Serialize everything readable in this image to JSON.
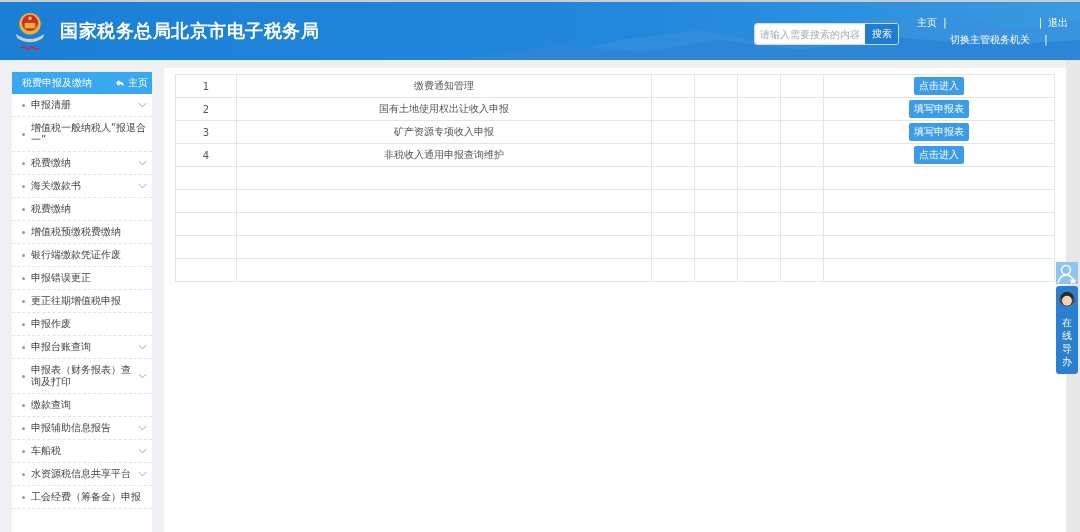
{
  "header": {
    "title": "国家税务总局北京市电子税务局",
    "search": {
      "placeholder": "请输入需要搜索的内容",
      "button": "搜索"
    },
    "links": [
      {
        "kind": "link",
        "label": "主页"
      },
      {
        "kind": "separator",
        "label": "|"
      },
      {
        "kind": "gap"
      },
      {
        "kind": "separator",
        "label": "|"
      },
      {
        "kind": "link",
        "label": "退出"
      }
    ],
    "switch_link": "切换主管税务机关",
    "switch_separator": "|"
  },
  "sidebar": {
    "title": "税费申报及缴纳",
    "home_link": "主页",
    "items": [
      {
        "label": "申报清册",
        "expandable": true
      },
      {
        "label": "增值税一般纳税人“报退合一”",
        "expandable": false
      },
      {
        "label": "税费缴纳",
        "expandable": true
      },
      {
        "label": "海关缴款书",
        "expandable": true
      },
      {
        "label": "税费缴纳",
        "expandable": false
      },
      {
        "label": "增值税预缴税费缴纳",
        "expandable": false
      },
      {
        "label": "银行端缴款凭证作废",
        "expandable": false
      },
      {
        "label": "申报错误更正",
        "expandable": false
      },
      {
        "label": "更正往期增值税申报",
        "expandable": false
      },
      {
        "label": "申报作废",
        "expandable": false
      },
      {
        "label": "申报台账查询",
        "expandable": true
      },
      {
        "label": "申报表（财务报表）查询及打印",
        "expandable": true
      },
      {
        "label": "缴款查询",
        "expandable": false
      },
      {
        "label": "申报辅助信息报告",
        "expandable": true
      },
      {
        "label": "车船税",
        "expandable": true
      },
      {
        "label": "水资源税信息共享平台",
        "expandable": true
      },
      {
        "label": "工会经费（筹备金）申报",
        "expandable": false
      }
    ]
  },
  "table": {
    "rows": [
      {
        "index": "1",
        "name": "缴费通知管理",
        "action": "点击进入"
      },
      {
        "index": "2",
        "name": "国有土地使用权出让收入申报",
        "action": "填写申报表"
      },
      {
        "index": "3",
        "name": "矿产资源专项收入申报",
        "action": "填写申报表"
      },
      {
        "index": "4",
        "name": "非税收入通用申报查询维护",
        "action": "点击进入"
      },
      {},
      {},
      {},
      {},
      {}
    ]
  },
  "online_guide": {
    "label": "在线导办"
  }
}
